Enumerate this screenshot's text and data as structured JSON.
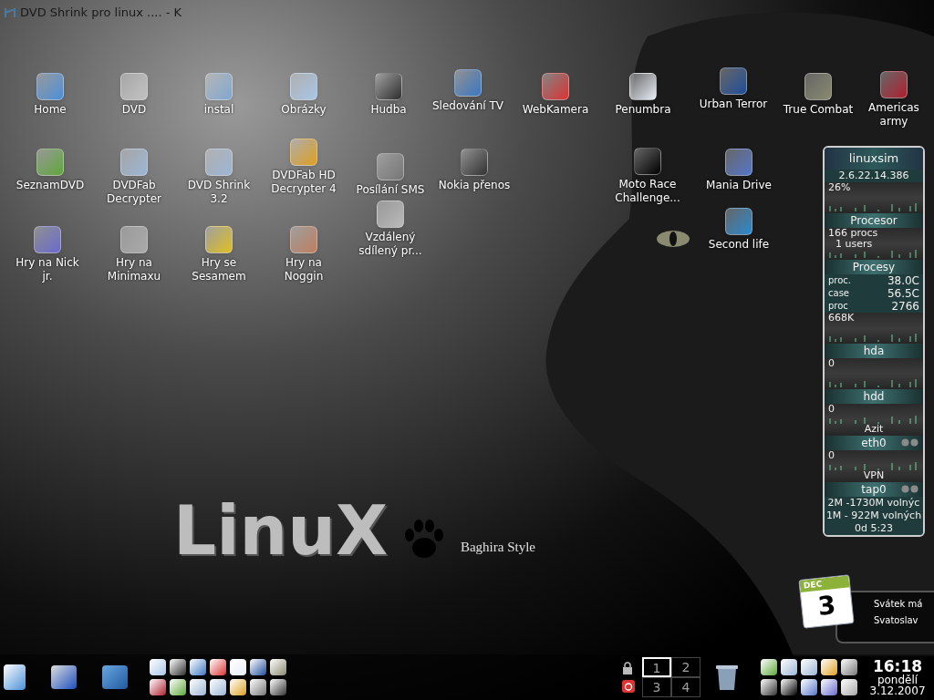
{
  "window_title": "DVD Shrink pro linux .... - K",
  "desktop_icons": [
    {
      "label": "Home"
    },
    {
      "label": "DVD"
    },
    {
      "label": "instal"
    },
    {
      "label": "Obrázky"
    },
    {
      "label": "Hudba"
    },
    {
      "label": "Sledování TV"
    },
    {
      "label": "WebKamera"
    },
    {
      "label": "Penumbra"
    },
    {
      "label": "Urban Terror"
    },
    {
      "label": "True Combat"
    },
    {
      "label": "Americas army"
    },
    {
      "label": "SeznamDVD"
    },
    {
      "label": "DVDFab Decrypter"
    },
    {
      "label": "DVD Shrink 3.2"
    },
    {
      "label": "DVDFab HD Decrypter 4"
    },
    {
      "label": "Posílání SMS"
    },
    {
      "label": "Nokia přenos"
    },
    {
      "label": "Moto Race Challenge..."
    },
    {
      "label": "Mania Drive"
    },
    {
      "label": "Hry na Nick jr."
    },
    {
      "label": "Hry na Minimaxu"
    },
    {
      "label": "Hry se Sesamem"
    },
    {
      "label": "Hry na Noggin"
    },
    {
      "label": "Vzdálený sdílený pr..."
    },
    {
      "label": "Second life"
    }
  ],
  "logo": {
    "text": "LinuX",
    "caption": "Baghira Style"
  },
  "monitor": [
    {
      "kind": "title",
      "text": "linuxsim"
    },
    {
      "kind": "text",
      "text": "2.6.22.14.386"
    },
    {
      "kind": "graph",
      "lines": [
        "26%"
      ]
    },
    {
      "kind": "header",
      "text": "Procesor"
    },
    {
      "kind": "graph",
      "lines": [
        "166 procs",
        "1 users"
      ]
    },
    {
      "kind": "header",
      "text": "Procesy"
    },
    {
      "kind": "reading",
      "label": "proc.",
      "value": "38.0C"
    },
    {
      "kind": "reading",
      "label": "case",
      "value": "56.5C"
    },
    {
      "kind": "reading",
      "label": "proc",
      "value": "2766"
    },
    {
      "kind": "graph",
      "lines": [
        "668K"
      ]
    },
    {
      "kind": "header",
      "text": "hda"
    },
    {
      "kind": "graph",
      "lines": [
        "0"
      ]
    },
    {
      "kind": "header",
      "text": "hdd"
    },
    {
      "kind": "graph",
      "lines": [
        "0"
      ],
      "caption": "Azit"
    },
    {
      "kind": "header",
      "text": "eth0",
      "leds": true
    },
    {
      "kind": "graph",
      "lines": [
        "0"
      ],
      "caption": "VPN"
    },
    {
      "kind": "header",
      "text": "tap0",
      "leds": true
    },
    {
      "kind": "text",
      "text": "2M -1730M volnýc"
    },
    {
      "kind": "text",
      "text": "1M - 922M volných"
    },
    {
      "kind": "text",
      "text": "0d  5:23"
    }
  ],
  "calendar": {
    "month": "DEC",
    "day": "3",
    "note": "Svátek má Svatoslav"
  },
  "pager": [
    {
      "label": "1",
      "selected": true
    },
    {
      "label": "2",
      "selected": false
    },
    {
      "label": "3",
      "selected": false
    },
    {
      "label": "4",
      "selected": false
    }
  ],
  "clock": {
    "time": "16:18",
    "weekday": "pondělí",
    "date": "3.12.2007"
  }
}
